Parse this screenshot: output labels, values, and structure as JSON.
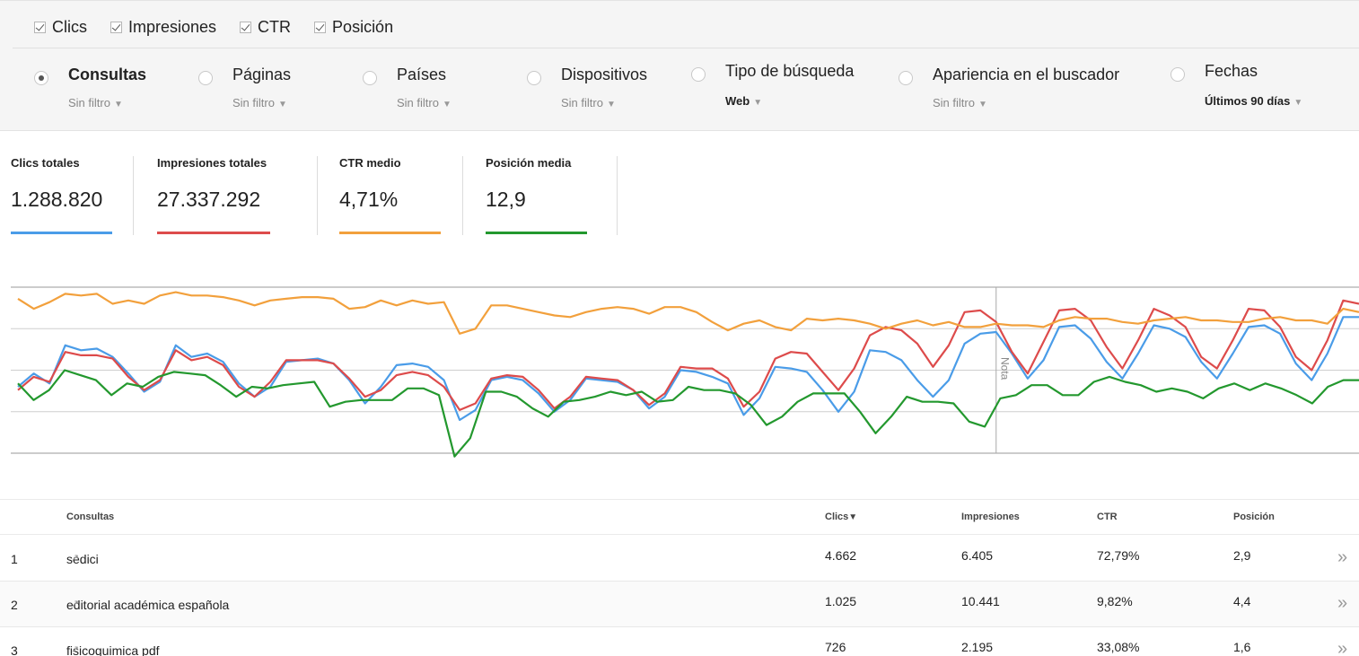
{
  "metric_checks": [
    {
      "label": "Clics",
      "checked": true
    },
    {
      "label": "Impresiones",
      "checked": true
    },
    {
      "label": "CTR",
      "checked": true
    },
    {
      "label": "Posición",
      "checked": true
    }
  ],
  "dimensions": [
    {
      "label": "Consultas",
      "filter": "Sin filtro",
      "selected": true
    },
    {
      "label": "Páginas",
      "filter": "Sin filtro",
      "selected": false
    },
    {
      "label": "Países",
      "filter": "Sin filtro",
      "selected": false
    },
    {
      "label": "Dispositivos",
      "filter": "Sin filtro",
      "selected": false
    },
    {
      "label": "Tipo de búsqueda",
      "filter": "Web",
      "selected": false
    },
    {
      "label": "Apariencia en el buscador",
      "filter": "Sin filtro",
      "selected": false
    },
    {
      "label": "Fechas",
      "filter": "Últimos 90 días",
      "selected": false
    }
  ],
  "summary": [
    {
      "label": "Clics totales",
      "value": "1.288.820",
      "color": "#4a9ce8"
    },
    {
      "label": "Impresiones totales",
      "value": "27.337.292",
      "color": "#dd4b4b"
    },
    {
      "label": "CTR medio",
      "value": "4,71%",
      "color": "#f2a03c"
    },
    {
      "label": "Posición media",
      "value": "12,9",
      "color": "#23982e"
    }
  ],
  "chart_data": {
    "type": "line",
    "annotation": "Nota",
    "annotation_index": 62,
    "series": [
      {
        "metric": "Clics",
        "color": "#4a9ce8",
        "values": [
          40,
          48,
          42,
          65,
          62,
          63,
          58,
          48,
          37,
          43,
          65,
          58,
          60,
          55,
          42,
          34,
          40,
          55,
          56,
          57,
          54,
          44,
          30,
          40,
          53,
          54,
          52,
          44,
          20,
          26,
          44,
          46,
          44,
          36,
          25,
          32,
          45,
          44,
          43,
          38,
          27,
          34,
          50,
          49,
          46,
          42,
          23,
          33,
          52,
          51,
          49,
          38,
          25,
          37,
          62,
          61,
          56,
          44,
          34,
          44,
          66,
          72,
          73,
          60,
          45,
          56,
          76,
          77,
          69,
          55,
          45,
          60,
          77,
          75,
          70,
          55,
          45,
          60,
          76,
          77,
          72,
          54,
          44,
          60,
          82,
          82
        ]
      },
      {
        "metric": "Impresiones",
        "color": "#dd4b4b",
        "values": [
          38,
          46,
          43,
          61,
          59,
          59,
          57,
          46,
          38,
          44,
          62,
          56,
          58,
          53,
          40,
          34,
          43,
          56,
          56,
          56,
          54,
          45,
          34,
          38,
          47,
          49,
          47,
          40,
          26,
          30,
          45,
          47,
          46,
          38,
          27,
          34,
          46,
          45,
          44,
          38,
          29,
          36,
          52,
          51,
          51,
          45,
          28,
          37,
          57,
          61,
          60,
          49,
          38,
          51,
          71,
          76,
          74,
          66,
          52,
          65,
          85,
          86,
          79,
          61,
          48,
          67,
          86,
          87,
          80,
          64,
          51,
          68,
          87,
          83,
          76,
          58,
          51,
          68,
          87,
          86,
          76,
          58,
          50,
          68,
          92,
          90
        ]
      },
      {
        "metric": "CTR",
        "color": "#f2a03c",
        "values": [
          93,
          87,
          91,
          96,
          95,
          96,
          90,
          92,
          90,
          95,
          97,
          95,
          95,
          94,
          92,
          89,
          92,
          93,
          94,
          94,
          93,
          87,
          88,
          92,
          89,
          92,
          90,
          91,
          72,
          75,
          89,
          89,
          87,
          85,
          83,
          82,
          85,
          87,
          88,
          87,
          84,
          88,
          88,
          85,
          79,
          74,
          78,
          80,
          76,
          74,
          81,
          80,
          81,
          80,
          78,
          75,
          78,
          80,
          77,
          79,
          76,
          76,
          78,
          77,
          77,
          76,
          80,
          82,
          81,
          81,
          79,
          78,
          80,
          81,
          82,
          80,
          80,
          79,
          79,
          81,
          82,
          80,
          80,
          78,
          87,
          85
        ]
      },
      {
        "metric": "Posición",
        "color": "#23982e",
        "values": [
          42,
          32,
          38,
          50,
          47,
          44,
          35,
          42,
          40,
          46,
          49,
          48,
          47,
          41,
          34,
          40,
          39,
          41,
          42,
          43,
          28,
          31,
          32,
          32,
          32,
          39,
          39,
          35,
          -2,
          9,
          37,
          37,
          34,
          27,
          22,
          31,
          32,
          34,
          37,
          35,
          37,
          31,
          32,
          40,
          38,
          38,
          36,
          29,
          17,
          22,
          31,
          36,
          36,
          36,
          25,
          12,
          22,
          34,
          31,
          31,
          30,
          19,
          16,
          33,
          35,
          41,
          41,
          35,
          35,
          43,
          46,
          43,
          41,
          37,
          39,
          37,
          33,
          39,
          42,
          38,
          42,
          39,
          35,
          30,
          40,
          44,
          44
        ]
      }
    ]
  },
  "table": {
    "headers": {
      "query": "Consultas",
      "clicks": "Clics",
      "sort_icon": "▼",
      "impressions": "Impresiones",
      "ctr": "CTR",
      "position": "Posición"
    },
    "rows": [
      {
        "index": "1",
        "query": "sedici",
        "clicks": "4.662",
        "impressions": "6.405",
        "ctr": "72,79%",
        "position": "2,9"
      },
      {
        "index": "2",
        "query": "editorial académica española",
        "clicks": "1.025",
        "impressions": "10.441",
        "ctr": "9,82%",
        "position": "4,4"
      },
      {
        "index": "3",
        "query": "fisicoquimica pdf",
        "clicks": "726",
        "impressions": "2.195",
        "ctr": "33,08%",
        "position": "1,6"
      }
    ]
  },
  "icons": {
    "external_link": "external-link-icon",
    "more": "double-chevron-right-icon",
    "caret": "caret-down-icon"
  }
}
